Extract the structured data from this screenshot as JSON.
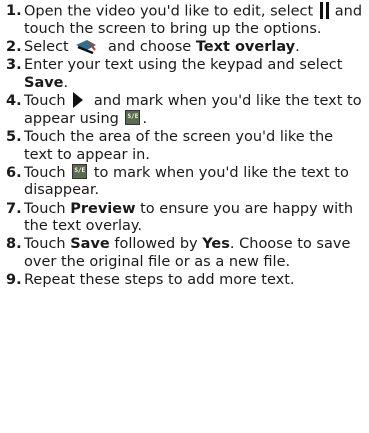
{
  "steps": [
    {
      "num": "1.",
      "before": "Open the video you'd like to edit, select",
      "after": "and touch the screen to bring up the options.",
      "icon": "pause-icon"
    },
    {
      "num": "2.",
      "before": "Select",
      "middle": "and choose",
      "bold": "Text overlay",
      "end": ".",
      "icon": "edit-icon"
    },
    {
      "num": "3.",
      "before": "Enter your text using the keypad and select",
      "bold": "Save",
      "end": "."
    },
    {
      "num": "4.",
      "before": "Touch",
      "after": "and mark when you'd like the text to appear using",
      "end": ".",
      "icon": "play-icon",
      "icon2": "start-end-marker-icon"
    },
    {
      "num": "5.",
      "text": "Touch the area of the screen you'd like the text to appear in."
    },
    {
      "num": "6.",
      "before": "Touch",
      "after": "to mark when you'd like the text to disappear.",
      "icon": "start-end-marker-icon"
    },
    {
      "num": "7.",
      "before": "Touch",
      "bold": "Preview",
      "after": "to ensure you are happy with the text overlay."
    },
    {
      "num": "8.",
      "before": "Touch",
      "bold": "Save",
      "middle": "followed by",
      "bold2": "Yes",
      "after": ". Choose to save over the original file or as a new file."
    },
    {
      "num": "9.",
      "text": "Repeat these steps to add more text."
    }
  ],
  "marker_glyph": "S/E",
  "colors": {
    "text": "#1a1a1a",
    "marker_bg": "#5a6b4e"
  }
}
